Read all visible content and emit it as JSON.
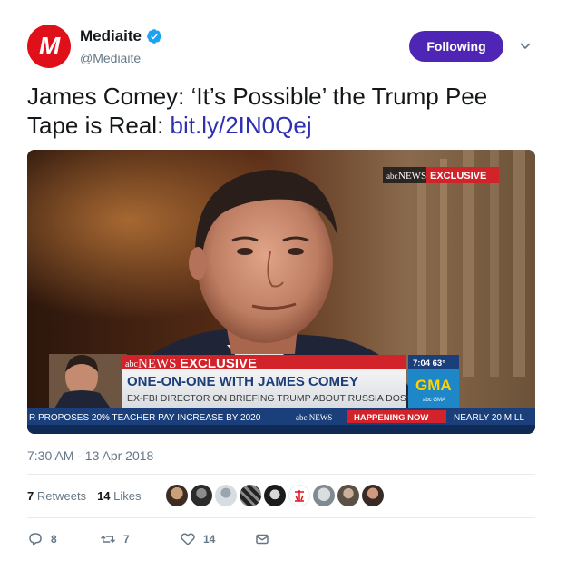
{
  "account": {
    "avatar_letter": "M",
    "display_name": "Mediaite",
    "handle": "@Mediaite",
    "verified_icon": "verified-badge-icon",
    "follow_label": "Following"
  },
  "tweet": {
    "text": "James Comey: ‘It’s Possible’ the Trump Pee Tape is Real: ",
    "link": "bit.ly/2IN0Qej",
    "timestamp": "7:30 AM - 13 Apr 2018"
  },
  "media": {
    "corner_bug_brand": "abc",
    "corner_bug_news": "NEWS",
    "corner_bug_exclusive": "EXCLUSIVE",
    "banner_brand": "abc",
    "banner_news": "NEWS",
    "banner_exclusive": "EXCLUSIVE",
    "headline": "ONE-ON-ONE WITH JAMES COMEY",
    "subheadline": "EX-FBI DIRECTOR ON BRIEFING TRUMP ABOUT RUSSIA DOSSIER",
    "time_temp": "7:04  63°",
    "show_logo": "GMA",
    "show_logo_sub": "abc GMA",
    "ticker_left": "R PROPOSES 20% TEACHER PAY INCREASE BY 2020",
    "ticker_brand": "abc NEWS",
    "ticker_happening": "HAPPENING NOW",
    "ticker_right": "NEARLY 20 MILL"
  },
  "stats": {
    "retweets_count": "7",
    "retweets_label": "Retweets",
    "likes_count": "14",
    "likes_label": "Likes"
  },
  "actions": {
    "replies": "8",
    "retweets": "7",
    "likes": "14"
  },
  "colors": {
    "follow_button": "#4f25b5",
    "link": "#2f2fb3",
    "avatar_bg": "#e0101b",
    "abc_red": "#d2232a",
    "verified": "#1da1f2"
  }
}
